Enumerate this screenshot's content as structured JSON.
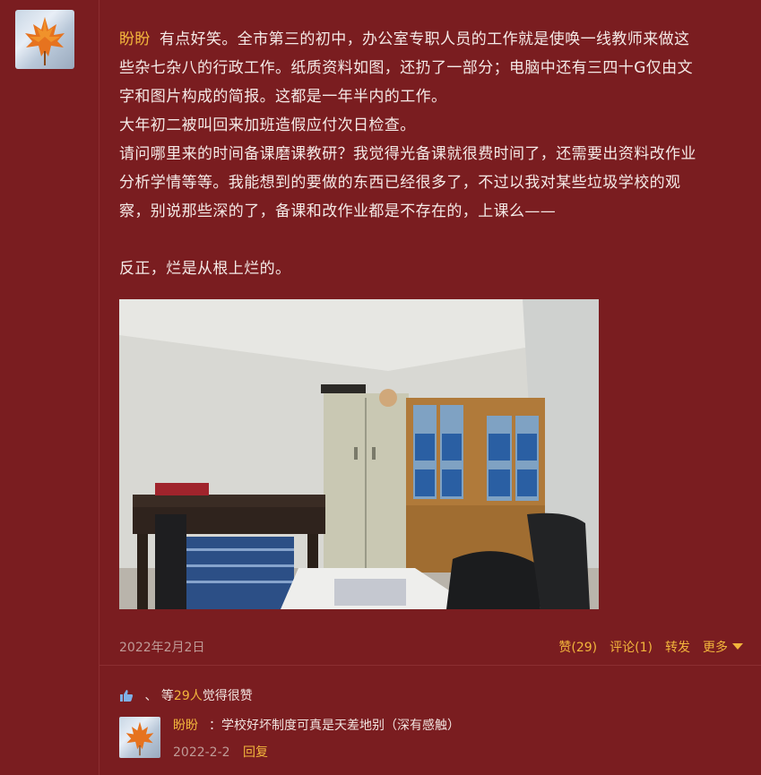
{
  "post": {
    "author": "盼盼",
    "paragraphs": [
      "有点好笑。全市第三的初中，办公室专职人员的工作就是使唤一线教师来做这",
      "些杂七杂八的行政工作。纸质资料如图，还扔了一部分；电脑中还有三四十G仅由文",
      "字和图片构成的简报。这都是一年半内的工作。",
      "大年初二被叫回来加班造假应付次日检查。",
      "请问哪里来的时间备课磨课教研？我觉得光备课就很费时间了，还需要出资料改作业",
      "分析学情等等。我能想到的要做的东西已经很多了，不过以我对某些垃圾学校的观",
      "察，别说那些深的了，备课和改作业都是不存在的，上课么——",
      "",
      "反正，烂是从根上烂的。"
    ],
    "date": "2022年2月2日",
    "actions": {
      "like": "赞(29)",
      "comment": "评论(1)",
      "repost": "转发",
      "more": "更多"
    }
  },
  "likes": {
    "prefix": "、 等",
    "count": "29人",
    "suffix": "觉得很赞"
  },
  "reply": {
    "author": "盼盼",
    "text": "：学校好坏制度可真是天差地别（深有感触）",
    "date": "2022-2-2",
    "reply_label": "回复"
  },
  "colors": {
    "background": "#7a1d20",
    "accent": "#f2b53c",
    "muted": "#bf9b97"
  },
  "icons": {
    "avatar": "maple-leaf-avatar",
    "thumb": "thumbs-up-icon",
    "more": "caret-down-icon"
  }
}
